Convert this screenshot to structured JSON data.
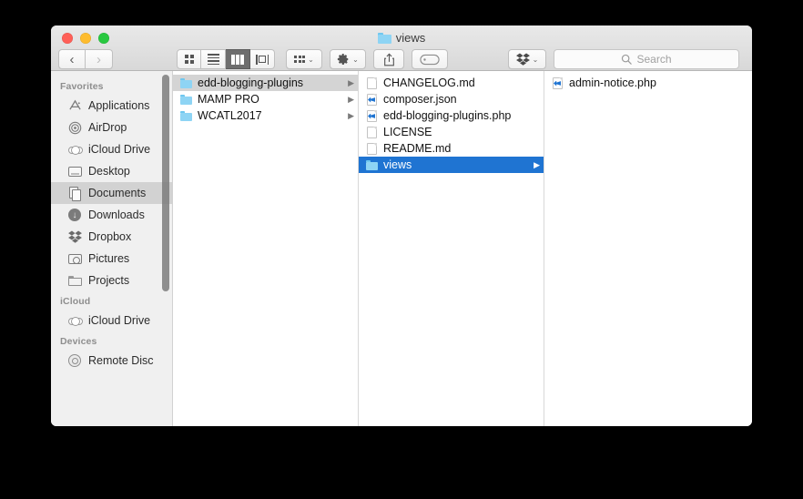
{
  "window": {
    "title": "views",
    "title_icon": "folder-icon",
    "traffic_lights": [
      "close-button",
      "minimize-button",
      "maximize-button"
    ]
  },
  "toolbar": {
    "back_label": "‹",
    "forward_label": "›",
    "view_modes": [
      {
        "name": "icon-view",
        "active": false
      },
      {
        "name": "list-view",
        "active": false
      },
      {
        "name": "column-view",
        "active": true
      },
      {
        "name": "gallery-view",
        "active": false
      }
    ],
    "arrange_icon": "arrange-icon",
    "action_icon": "gear-icon",
    "share_icon": "share-icon",
    "tag_icon": "tag-icon",
    "dropbox_icon": "dropbox-icon",
    "chevron": "⌄"
  },
  "search": {
    "placeholder": "Search",
    "value": "",
    "icon": "search-icon"
  },
  "sidebar": {
    "sections": [
      {
        "header": "Favorites",
        "items": [
          {
            "label": "Applications",
            "icon": "applications-icon",
            "selected": false
          },
          {
            "label": "AirDrop",
            "icon": "airdrop-icon",
            "selected": false
          },
          {
            "label": "iCloud Drive",
            "icon": "icloud-icon",
            "selected": false
          },
          {
            "label": "Desktop",
            "icon": "desktop-icon",
            "selected": false
          },
          {
            "label": "Documents",
            "icon": "documents-icon",
            "selected": true
          },
          {
            "label": "Downloads",
            "icon": "downloads-icon",
            "selected": false
          },
          {
            "label": "Dropbox",
            "icon": "dropbox-icon",
            "selected": false
          },
          {
            "label": "Pictures",
            "icon": "pictures-icon",
            "selected": false
          },
          {
            "label": "Projects",
            "icon": "folder-icon",
            "selected": false
          }
        ]
      },
      {
        "header": "iCloud",
        "items": [
          {
            "label": "iCloud Drive",
            "icon": "icloud-icon",
            "selected": false
          }
        ]
      },
      {
        "header": "Devices",
        "items": [
          {
            "label": "Remote Disc",
            "icon": "disc-icon",
            "selected": false
          }
        ]
      }
    ]
  },
  "columns": [
    {
      "name": "column-1",
      "items": [
        {
          "label": "edd-blogging-plugins",
          "icon": "folder-icon",
          "selection": "gray",
          "disclosure": true
        },
        {
          "label": "MAMP PRO",
          "icon": "folder-icon",
          "selection": "none",
          "disclosure": true
        },
        {
          "label": "WCATL2017",
          "icon": "folder-icon",
          "selection": "none",
          "disclosure": true
        }
      ]
    },
    {
      "name": "column-2",
      "items": [
        {
          "label": "CHANGELOG.md",
          "icon": "document-icon",
          "selection": "none",
          "disclosure": false
        },
        {
          "label": "composer.json",
          "icon": "code-file-icon",
          "selection": "none",
          "disclosure": false
        },
        {
          "label": "edd-blogging-plugins.php",
          "icon": "code-file-icon",
          "selection": "none",
          "disclosure": false
        },
        {
          "label": "LICENSE",
          "icon": "document-icon",
          "selection": "none",
          "disclosure": false
        },
        {
          "label": "README.md",
          "icon": "document-icon",
          "selection": "none",
          "disclosure": false
        },
        {
          "label": "views",
          "icon": "folder-icon",
          "selection": "blue",
          "disclosure": true
        }
      ]
    },
    {
      "name": "column-3",
      "items": [
        {
          "label": "admin-notice.php",
          "icon": "code-file-icon",
          "selection": "none",
          "disclosure": false
        }
      ]
    }
  ],
  "colors": {
    "selection_blue": "#1f74d2",
    "selection_gray": "#d4d4d4",
    "folder_blue": "#8ed4f4",
    "sidebar_bg": "#f0f0f0"
  }
}
